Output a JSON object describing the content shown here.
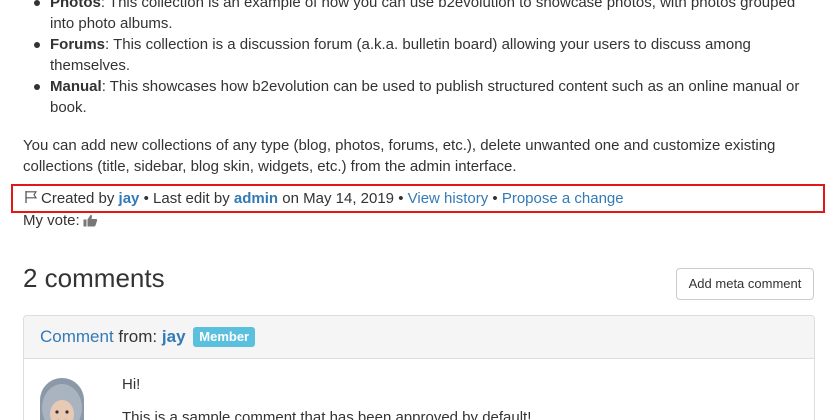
{
  "collections": [
    {
      "term": "Photos",
      "text": ": This collection is an example of how you can use b2evolution to showcase photos, with photos grouped into photo albums."
    },
    {
      "term": "Forums",
      "text": ": This collection is a discussion forum (a.k.a. bulletin board) allowing your users to discuss among themselves."
    },
    {
      "term": "Manual",
      "text": ": This showcases how b2evolution can be used to publish structured content such as an online manual or book."
    }
  ],
  "intro": "You can add new collections of any type (blog, photos, forums, etc.), delete unwanted one and customize existing collections (title, sidebar, blog skin, widgets, etc.) from the admin interface.",
  "item_info": {
    "created_by_label": "Created by",
    "creator": "jay",
    "sep1": "•",
    "last_edit_label": "Last edit by",
    "editor": "admin",
    "on_label": "on",
    "date": "May 14, 2019",
    "sep2": "•",
    "view_history": "View history",
    "sep3": "•",
    "propose_change": "Propose a change"
  },
  "vote": {
    "label": "My vote:"
  },
  "comments": {
    "title": "2 comments",
    "add_meta_button": "Add meta comment",
    "first": {
      "type_link": "Comment",
      "from_label": "from:",
      "author": "jay",
      "badge": "Member",
      "lines": [
        "Hi!",
        "This is a sample comment that has been approved by default!"
      ]
    }
  },
  "colors": {
    "link": "#337ab7",
    "badge": "#5bc0de",
    "highlight_border": "#e01818"
  },
  "icons": [
    "flag-icon",
    "thumbs-up-icon"
  ]
}
